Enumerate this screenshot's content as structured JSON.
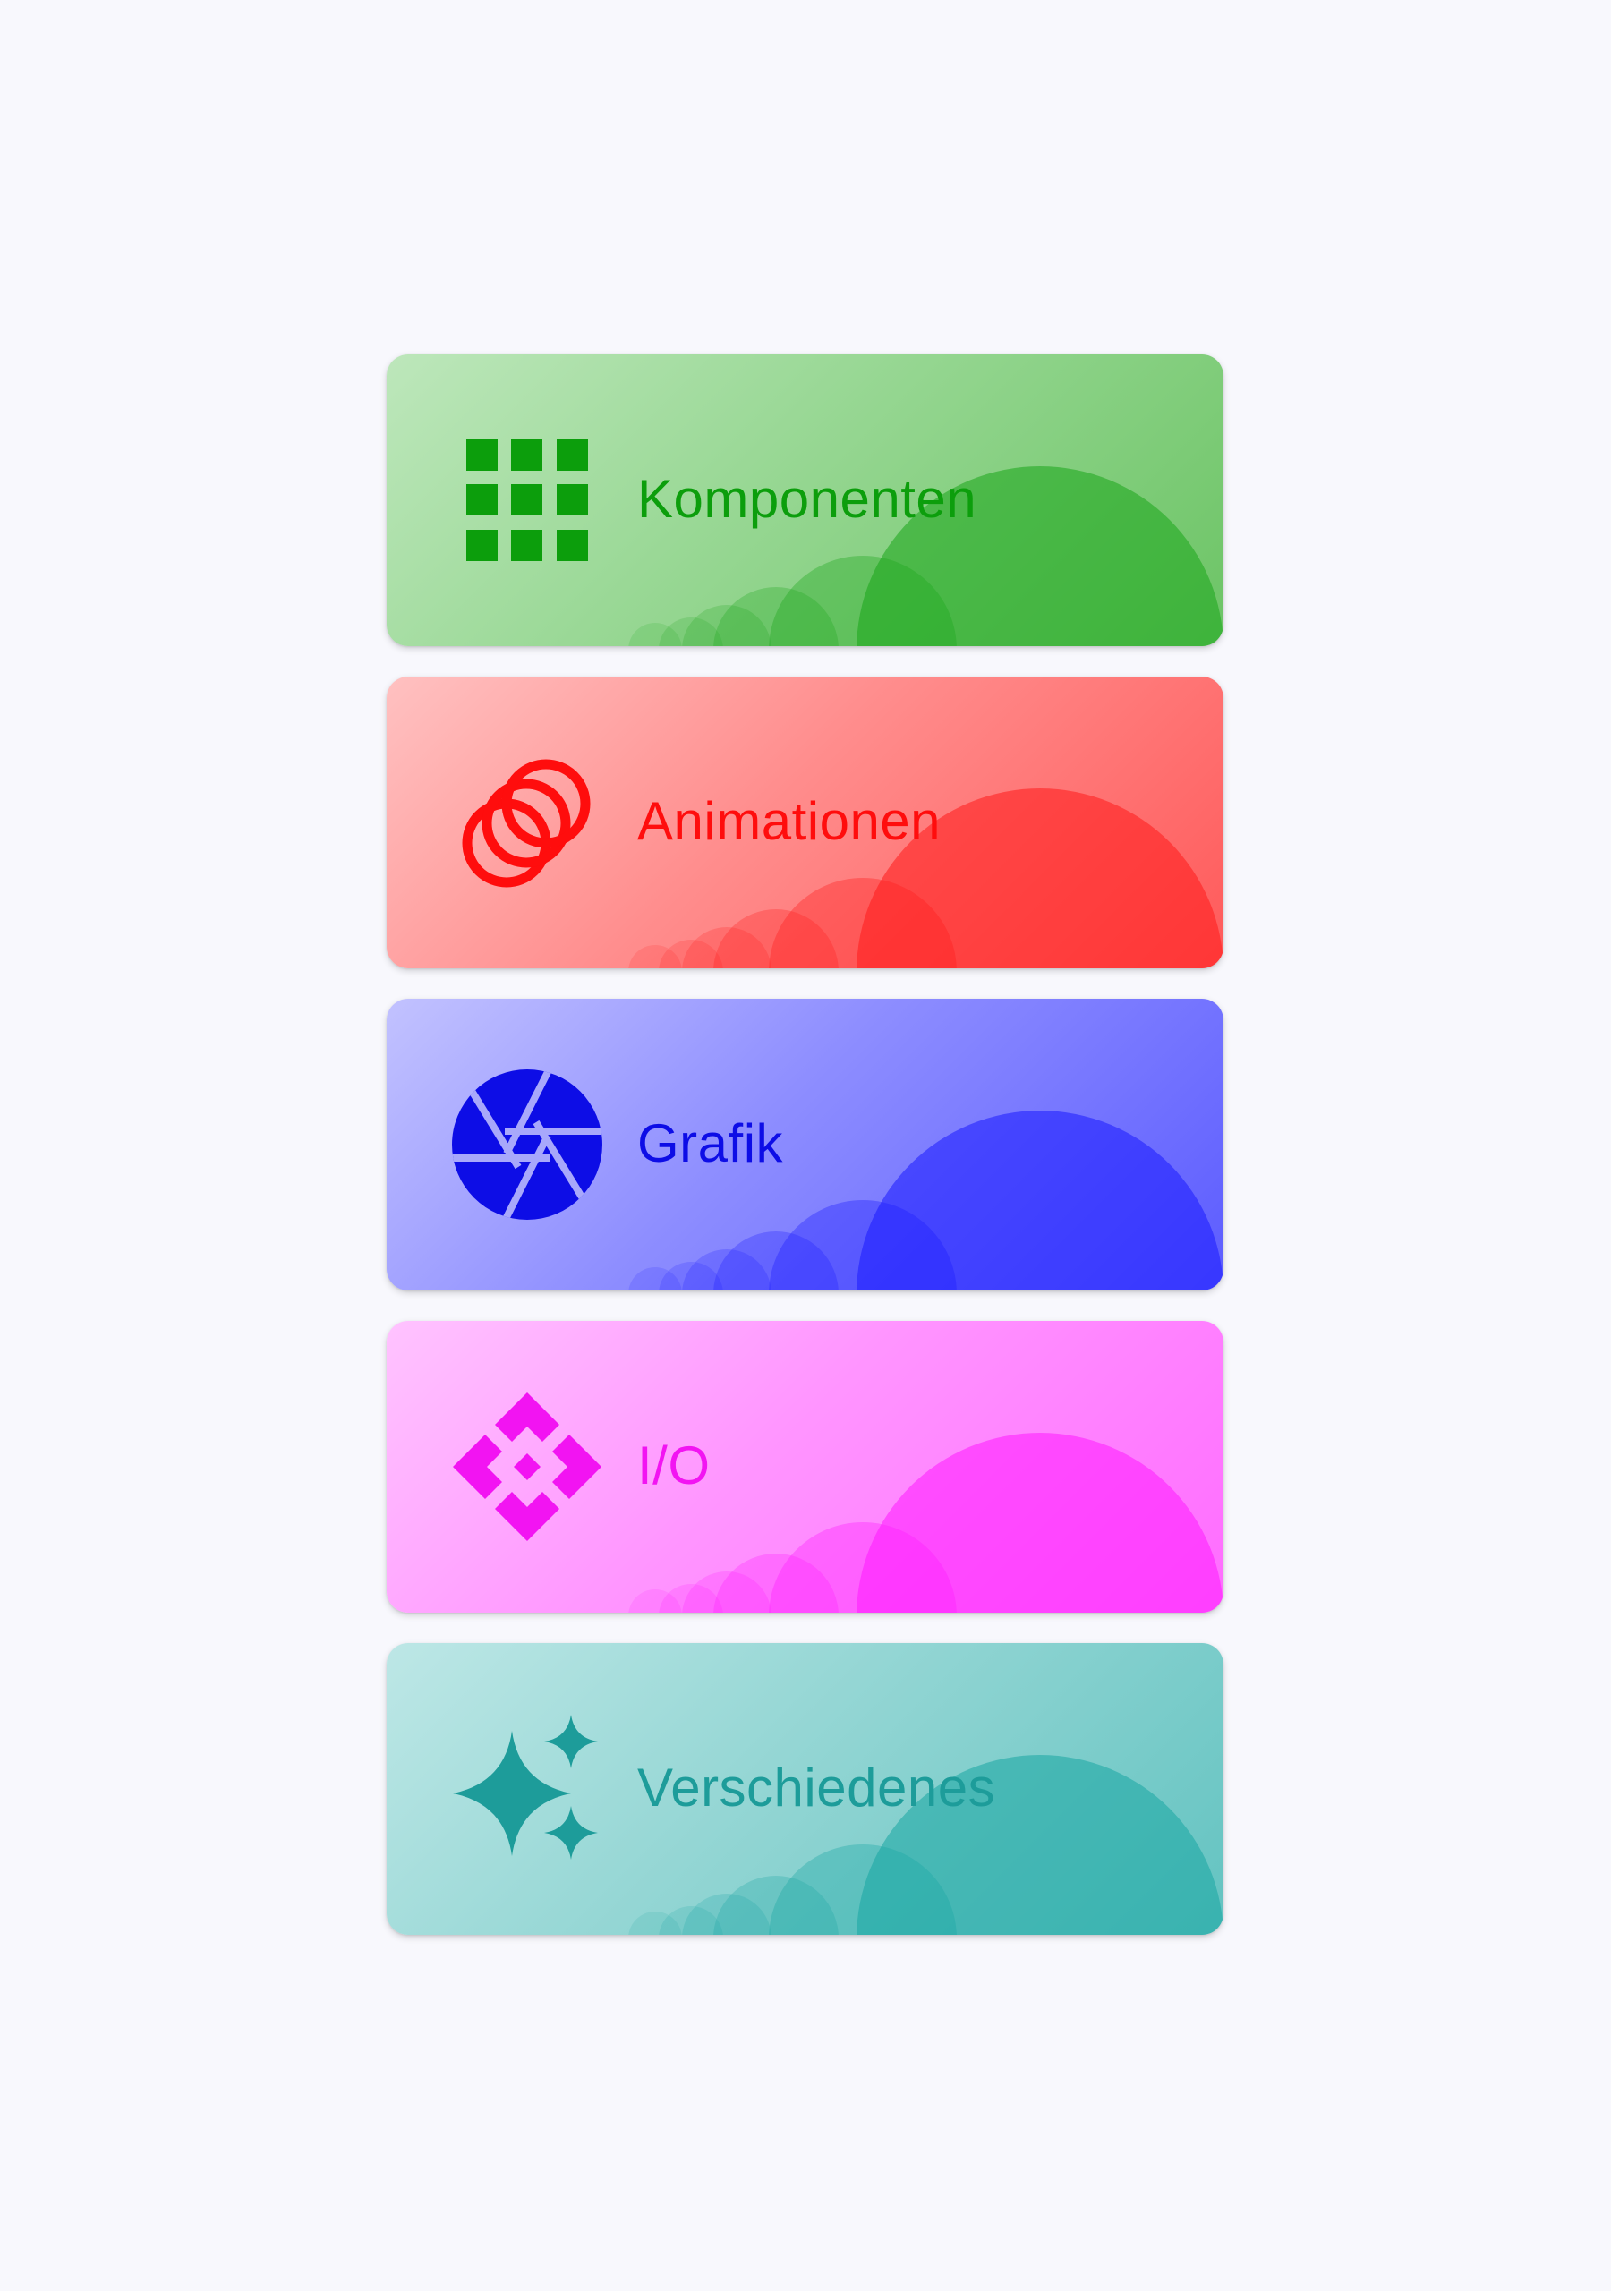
{
  "categories": [
    {
      "key": "green",
      "label": "Komponenten",
      "icon": "grid-icon",
      "accent": "#0c9e0c",
      "bubble": "#1aa51a"
    },
    {
      "key": "red",
      "label": "Animationen",
      "icon": "rings-icon",
      "accent": "#ff0d0d",
      "bubble": "#ff1a1a"
    },
    {
      "key": "blue",
      "label": "Grafik",
      "icon": "aperture-icon",
      "accent": "#0d0de6",
      "bubble": "#1a1aff"
    },
    {
      "key": "magenta",
      "label": "I/O",
      "icon": "diamond-icon",
      "accent": "#f214f2",
      "bubble": "#ff1aff"
    },
    {
      "key": "teal",
      "label": "Verschiedenes",
      "icon": "sparkle-icon",
      "accent": "#1d9c9a",
      "bubble": "#18a5a2"
    }
  ]
}
